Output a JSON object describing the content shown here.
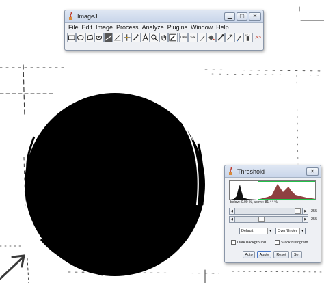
{
  "imagej": {
    "title": "ImageJ",
    "menus": [
      "File",
      "Edit",
      "Image",
      "Process",
      "Analyze",
      "Plugins",
      "Window",
      "Help"
    ],
    "tools": [
      {
        "icon": "rectangle-tool-icon"
      },
      {
        "icon": "oval-tool-icon"
      },
      {
        "icon": "polygon-tool-icon"
      },
      {
        "icon": "freehand-tool-icon"
      },
      {
        "icon": "straight-line-tool-icon",
        "active": true
      },
      {
        "icon": "angle-tool-icon"
      },
      {
        "icon": "point-tool-icon"
      },
      {
        "icon": "wand-tool-icon"
      },
      {
        "icon": "text-tool-icon"
      },
      {
        "icon": "magnifying-glass-icon"
      },
      {
        "icon": "hand-tool-icon"
      },
      {
        "icon": "color-picker-icon"
      },
      {
        "icon": "dev-tool-icon",
        "label": "Dev"
      },
      {
        "icon": "stk-tool-icon",
        "label": "Stk"
      },
      {
        "icon": "pencil-icon"
      },
      {
        "icon": "flood-fill-icon"
      },
      {
        "icon": "pipette-icon"
      },
      {
        "icon": "arrow-tool-icon"
      },
      {
        "icon": "brush-tool-icon"
      },
      {
        "icon": "spray-can-icon"
      }
    ],
    "more_label": ">>"
  },
  "threshold": {
    "title": "Threshold",
    "caption": "below: 0.00 %,  above: 81.44 %",
    "slider1_value": "255",
    "slider2_value": "255",
    "method": "Default",
    "mode": "Over/Under",
    "dark_background": "Dark background",
    "stack_histogram": "Stack histogram",
    "buttons": {
      "auto": "Auto",
      "apply": "Apply",
      "reset": "Reset",
      "set": "Set"
    }
  },
  "colors": {
    "foreground": "#000000",
    "selection_green": "#22c04a"
  }
}
